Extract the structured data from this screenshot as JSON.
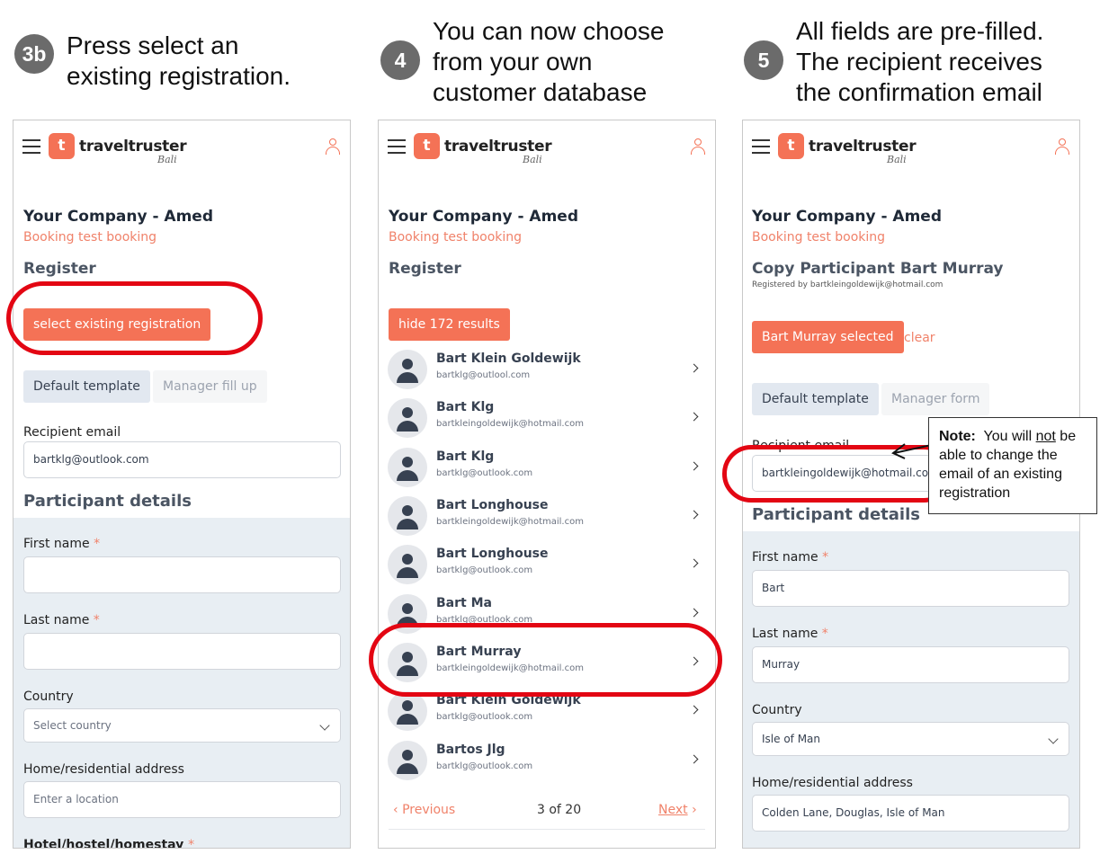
{
  "steps": [
    {
      "badge": "3b",
      "text": "Press select an\nexisting registration."
    },
    {
      "badge": "4",
      "text": "You can now choose\nfrom your own\ncustomer database"
    },
    {
      "badge": "5",
      "text": "All fields are pre-filled.\nThe recipient receives\nthe confirmation email"
    }
  ],
  "app": {
    "brand": "traveltruster",
    "region": "Bali",
    "logo_glyph": "t"
  },
  "common": {
    "company": "Your Company - Amed",
    "booking": "Booking test booking",
    "register": "Register"
  },
  "panel1": {
    "select_button": "select existing registration",
    "template_default": "Default template",
    "template_manager": "Manager fill up",
    "recipient_label": "Recipient email",
    "recipient_value": "bartklg@outlook.com",
    "participant_heading": "Participant details",
    "first_name_label": "First name",
    "last_name_label": "Last name",
    "country_label": "Country",
    "country_placeholder": "Select country",
    "address_label": "Home/residential address",
    "address_placeholder": "Enter a location",
    "hotel_label": "Hotel/hostel/homestay",
    "required": "*"
  },
  "panel2": {
    "hide_button": "hide 172 results",
    "results": [
      {
        "name": "Bart Klein Goldewijk",
        "email": "bartklg@outlool.com"
      },
      {
        "name": "Bart Klg",
        "email": "bartkleingoldewijk@hotmail.com"
      },
      {
        "name": "Bart Klg",
        "email": "bartklg@outlook.com"
      },
      {
        "name": "Bart Longhouse",
        "email": "bartkleingoldewijk@hotmail.com"
      },
      {
        "name": "Bart Longhouse",
        "email": "bartklg@outlook.com"
      },
      {
        "name": "Bart Ma",
        "email": "bartklg@outlook.com"
      },
      {
        "name": "Bart Murray",
        "email": "bartkleingoldewijk@hotmail.com"
      },
      {
        "name": "Bart Klein Goldewijk",
        "email": "bartklg@outlook.com"
      },
      {
        "name": "Bartos Jlg",
        "email": "bartklg@outlook.com"
      }
    ],
    "prev": "Previous",
    "page": "3 of 20",
    "next": "Next"
  },
  "panel3": {
    "copy_title": "Copy Participant Bart Murray",
    "registered_by": "Registered by bartkleingoldewijk@hotmail.com",
    "selected_button": "Bart Murray selected",
    "clear": "clear",
    "template_default": "Default template",
    "template_manager": "Manager form",
    "recipient_label": "Recipient email",
    "recipient_value": "bartkleingoldewijk@hotmail.com",
    "participant_heading": "Participant details",
    "first_name_label": "First name",
    "first_name_value": "Bart",
    "last_name_label": "Last name",
    "last_name_value": "Murray",
    "country_label": "Country",
    "country_value": "Isle of Man",
    "address_label": "Home/residential address",
    "address_value": "Colden Lane, Douglas, Isle of Man",
    "required": "*"
  },
  "note": {
    "bold": "Note:",
    "pre": "You will ",
    "underline": "not",
    "post": " be able to change the email of an existing registration"
  },
  "colors": {
    "accent": "#f47256",
    "highlight": "#e30613",
    "panel_bg": "#e8eef3"
  }
}
